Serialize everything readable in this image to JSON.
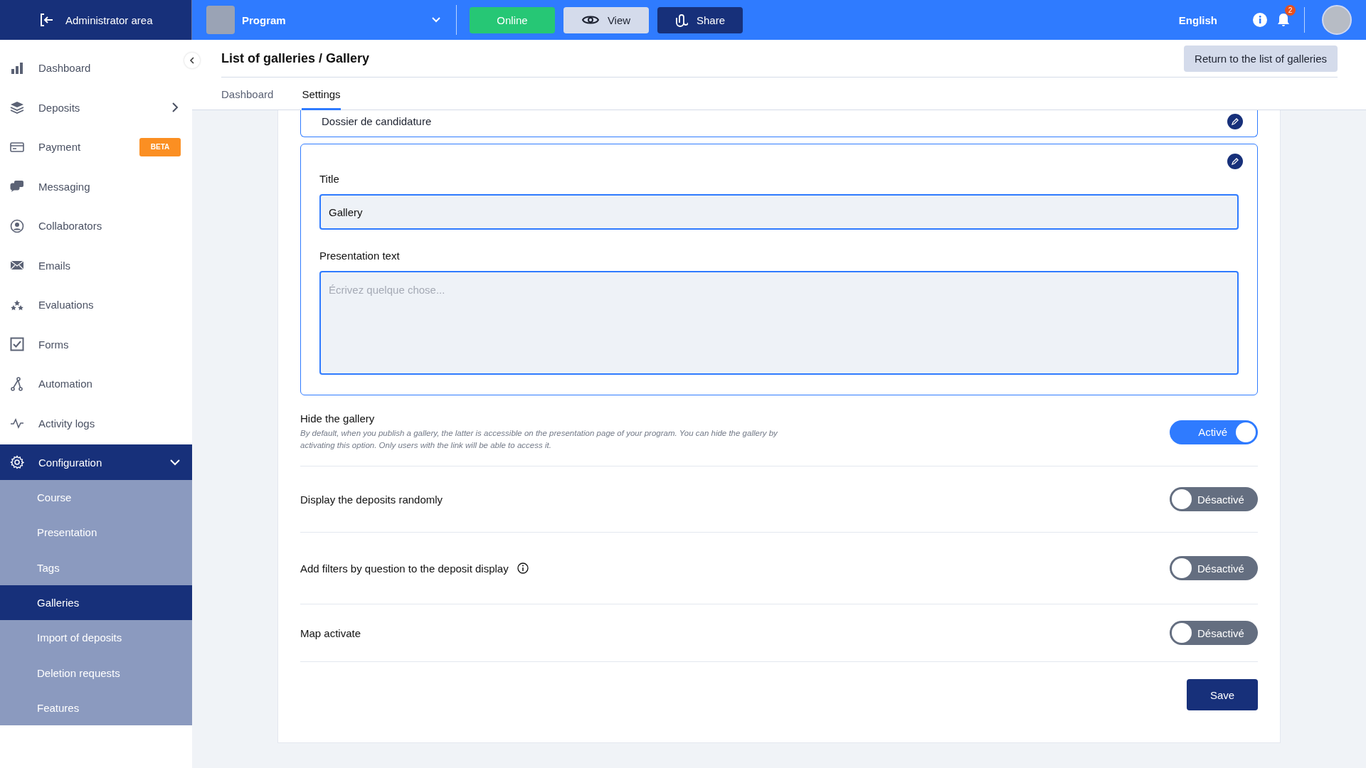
{
  "topbar": {
    "admin_area": "Administrator area",
    "program": "Program",
    "buttons": [
      {
        "label": "Online",
        "kind": "status"
      },
      {
        "label": "View",
        "kind": "view"
      },
      {
        "label": "Share",
        "kind": "share"
      }
    ],
    "language": "English",
    "notifications": "2"
  },
  "sidebar": {
    "items": [
      {
        "label": "Dashboard",
        "selected": false
      },
      {
        "label": "Deposits",
        "selected": false,
        "expanded": false
      },
      {
        "label": "Payment",
        "selected": false,
        "badge": "BETA"
      },
      {
        "label": "Messaging",
        "selected": false
      },
      {
        "label": "Collaborators",
        "selected": false
      },
      {
        "label": "Emails",
        "selected": false
      },
      {
        "label": "Evaluations",
        "selected": false
      },
      {
        "label": "Forms",
        "selected": false
      },
      {
        "label": "Automation",
        "selected": false
      },
      {
        "label": "Activity logs",
        "selected": false
      },
      {
        "label": "Configuration",
        "selected": true,
        "expanded": true,
        "children": [
          {
            "label": "Course",
            "selected": false
          },
          {
            "label": "Presentation",
            "selected": false
          },
          {
            "label": "Tags",
            "selected": false
          },
          {
            "label": "Galleries",
            "selected": true
          },
          {
            "label": "Import of deposits",
            "selected": false
          },
          {
            "label": "Deletion requests",
            "selected": false
          },
          {
            "label": "Features",
            "selected": false
          }
        ]
      }
    ]
  },
  "header": {
    "title": "List of galleries / Gallery",
    "return_button": "Return to the list of galleries",
    "tabs": [
      {
        "label": "Dashboard",
        "selected": false
      },
      {
        "label": "Settings",
        "selected": true
      }
    ]
  },
  "previous_card": {
    "title": "Dossier de candidature"
  },
  "gallery_card": {
    "fields": [
      {
        "kind": "input",
        "label": "Title",
        "value": "Gallery"
      },
      {
        "kind": "textarea",
        "label": "Presentation text",
        "placeholder": "Écrivez quelque chose..."
      }
    ]
  },
  "options": [
    {
      "label": "Hide the gallery",
      "description": "By default, when you publish a gallery, the latter is accessible on the presentation page of your program. You can hide the gallery by activating this option. Only users with the link will be able to access it.",
      "on": true,
      "state_label": "Activé"
    },
    {
      "label": "Display the deposits randomly",
      "on": false,
      "state_label": "Désactivé"
    },
    {
      "label": "Add filters by question to the deposit display",
      "info": true,
      "on": false,
      "state_label": "Désactivé"
    },
    {
      "label": "Map activate",
      "on": false,
      "state_label": "Désactivé"
    }
  ],
  "save_button": "Save"
}
